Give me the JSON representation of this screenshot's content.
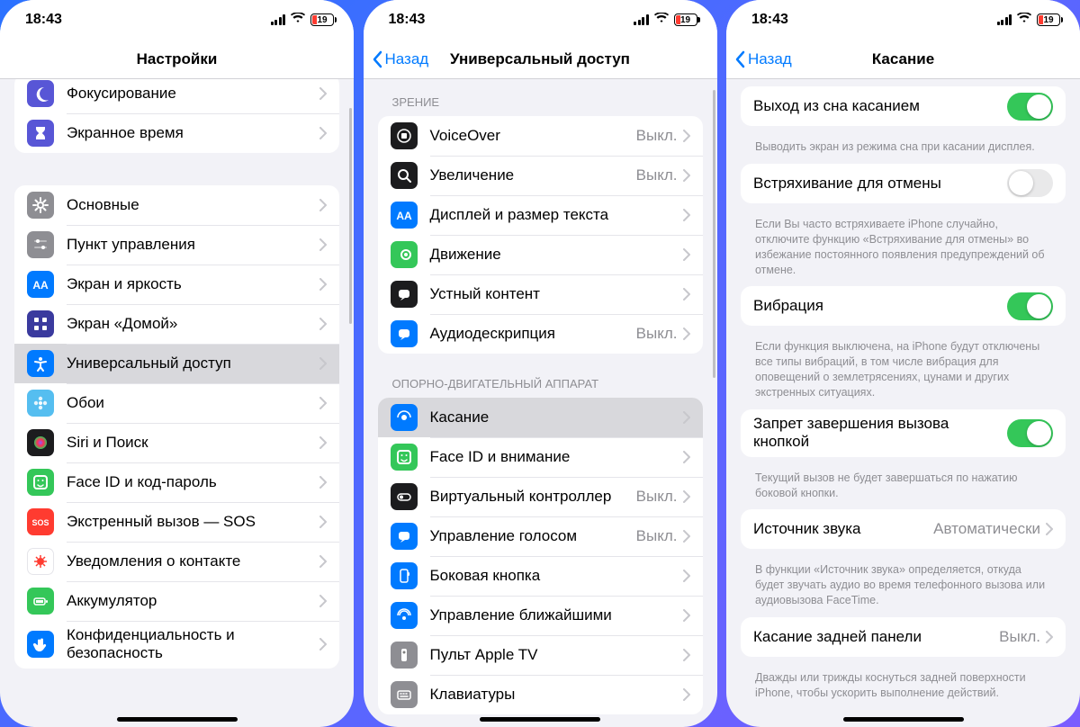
{
  "status": {
    "time": "18:43",
    "battery": "19"
  },
  "screen1": {
    "title": "Настройки",
    "groups": [
      {
        "items": [
          {
            "icon": "moon-icon",
            "color": "#5856d6",
            "label": "Фокусирование"
          },
          {
            "icon": "hourglass-icon",
            "color": "#5856d6",
            "label": "Экранное время"
          }
        ]
      },
      {
        "items": [
          {
            "icon": "gear-icon",
            "color": "#8e8e93",
            "label": "Основные"
          },
          {
            "icon": "sliders-icon",
            "color": "#8e8e93",
            "label": "Пункт управления"
          },
          {
            "icon": "aa-icon",
            "color": "#007aff",
            "label": "Экран и яркость"
          },
          {
            "icon": "grid-icon",
            "color": "#3a3a9e",
            "label": "Экран «Домой»"
          },
          {
            "icon": "accessibility-icon",
            "color": "#007aff",
            "label": "Универсальный доступ",
            "selected": true
          },
          {
            "icon": "flower-icon",
            "color": "#55bef0",
            "label": "Обои"
          },
          {
            "icon": "siri-icon",
            "color": "#1c1c1e",
            "label": "Siri и Поиск"
          },
          {
            "icon": "faceid-icon",
            "color": "#34c759",
            "label": "Face ID и код-пароль"
          },
          {
            "icon": "sos-icon",
            "color": "#ff3b30",
            "label": "Экстренный вызов — SOS"
          },
          {
            "icon": "virus-icon",
            "color": "#ffffff",
            "label": "Уведомления о контакте",
            "fg": "#ff3b30",
            "border": true
          },
          {
            "icon": "battery-icon",
            "color": "#34c759",
            "label": "Аккумулятор"
          },
          {
            "icon": "hand-icon",
            "color": "#007aff",
            "label": "Конфиденциальность и безопасность"
          }
        ]
      }
    ]
  },
  "screen2": {
    "back": "Назад",
    "title": "Универсальный доступ",
    "sections": [
      {
        "header": "ЗРЕНИЕ",
        "items": [
          {
            "icon": "voiceover-icon",
            "color": "#1c1c1e",
            "label": "VoiceOver",
            "value": "Выкл."
          },
          {
            "icon": "zoom-icon",
            "color": "#1c1c1e",
            "label": "Увеличение",
            "value": "Выкл."
          },
          {
            "icon": "aa-icon",
            "color": "#007aff",
            "label": "Дисплей и размер текста"
          },
          {
            "icon": "motion-icon",
            "color": "#34c759",
            "label": "Движение"
          },
          {
            "icon": "speech-icon",
            "color": "#1c1c1e",
            "label": "Устный контент"
          },
          {
            "icon": "audiodesc-icon",
            "color": "#007aff",
            "label": "Аудиодескрипция",
            "value": "Выкл."
          }
        ]
      },
      {
        "header": "ОПОРНО-ДВИГАТЕЛЬНЫЙ АППАРАТ",
        "items": [
          {
            "icon": "touch-icon",
            "color": "#007aff",
            "label": "Касание",
            "selected": true
          },
          {
            "icon": "faceid-icon",
            "color": "#34c759",
            "label": "Face ID и внимание"
          },
          {
            "icon": "switch-icon",
            "color": "#1c1c1e",
            "label": "Виртуальный контроллер",
            "value": "Выкл."
          },
          {
            "icon": "voice-ctrl-icon",
            "color": "#007aff",
            "label": "Управление голосом",
            "value": "Выкл."
          },
          {
            "icon": "sidebtn-icon",
            "color": "#007aff",
            "label": "Боковая кнопка"
          },
          {
            "icon": "nearby-icon",
            "color": "#007aff",
            "label": "Управление ближайшими"
          },
          {
            "icon": "remote-icon",
            "color": "#8e8e93",
            "label": "Пульт Apple TV"
          },
          {
            "icon": "keyboard-icon",
            "color": "#8e8e93",
            "label": "Клавиатуры"
          }
        ]
      }
    ]
  },
  "screen3": {
    "back": "Назад",
    "title": "Касание",
    "rows": [
      {
        "type": "toggle",
        "label": "Выход из сна касанием",
        "on": true
      },
      {
        "type": "footer",
        "text": "Выводить экран из режима сна при касании дисплея."
      },
      {
        "type": "toggle",
        "label": "Встряхивание для отмены",
        "on": false
      },
      {
        "type": "footer",
        "text": "Если Вы часто встряхиваете iPhone случайно, отключите функцию «Встряхивание для отмены» во избежание постоянного появления предупреждений об отмене."
      },
      {
        "type": "toggle",
        "label": "Вибрация",
        "on": true
      },
      {
        "type": "footer",
        "text": "Если функция выключена, на iPhone будут отключены все типы вибраций, в том числе вибрация для оповещений о землетрясениях, цунами и других экстренных ситуациях."
      },
      {
        "type": "toggle",
        "label": "Запрет завершения вызова кнопкой",
        "on": true
      },
      {
        "type": "footer",
        "text": "Текущий вызов не будет завершаться по нажатию боковой кнопки."
      },
      {
        "type": "link",
        "label": "Источник звука",
        "value": "Автоматически"
      },
      {
        "type": "footer",
        "text": "В функции «Источник звука» определяется, откуда будет звучать аудио во время телефонного вызова или аудиовызова FaceTime."
      },
      {
        "type": "link",
        "label": "Касание задней панели",
        "value": "Выкл."
      },
      {
        "type": "footer",
        "text": "Дважды или трижды коснуться задней поверхности iPhone, чтобы ускорить выполнение действий."
      }
    ]
  }
}
